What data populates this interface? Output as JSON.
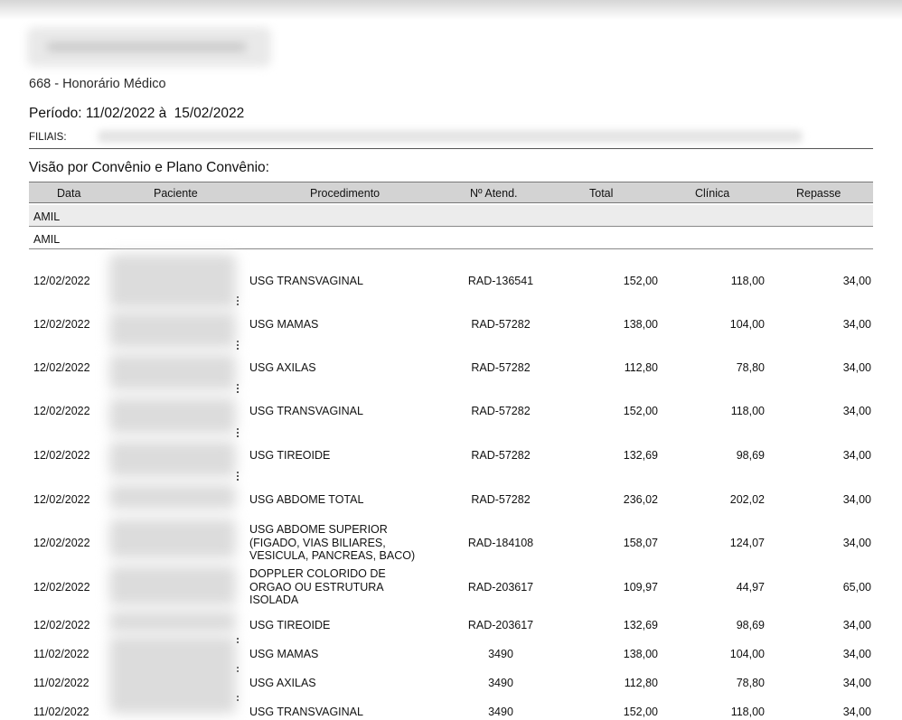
{
  "report": {
    "code_title": "668 - Honorário Médico",
    "period_label": "Período:",
    "period_start": "11/02/2022",
    "period_sep": "à",
    "period_end": "15/02/2022",
    "filiais_label": "FILIAIS:",
    "section_title": "Visão por Convênio e Plano Convênio:"
  },
  "table": {
    "headers": [
      "Data",
      "Paciente",
      "Procedimento",
      "Nº Atend.",
      "Total",
      "Clínica",
      "Repasse"
    ],
    "convenio": "AMIL",
    "plano": "AMIL",
    "rows": [
      {
        "date": "12/02/2022",
        "proc": [
          "USG TRANSVAGINAL"
        ],
        "atend": "RAD-136541",
        "total": "152,00",
        "clinica": "118,00",
        "repasse": "34,00"
      },
      {
        "date": "12/02/2022",
        "proc": [
          "USG MAMAS"
        ],
        "atend": "RAD-57282",
        "total": "138,00",
        "clinica": "104,00",
        "repasse": "34,00"
      },
      {
        "date": "12/02/2022",
        "proc": [
          "USG AXILAS"
        ],
        "atend": "RAD-57282",
        "total": "112,80",
        "clinica": "78,80",
        "repasse": "34,00"
      },
      {
        "date": "12/02/2022",
        "proc": [
          "USG TRANSVAGINAL"
        ],
        "atend": "RAD-57282",
        "total": "152,00",
        "clinica": "118,00",
        "repasse": "34,00"
      },
      {
        "date": "12/02/2022",
        "proc": [
          "USG TIREOIDE"
        ],
        "atend": "RAD-57282",
        "total": "132,69",
        "clinica": "98,69",
        "repasse": "34,00"
      },
      {
        "date": "12/02/2022",
        "proc": [
          "USG ABDOME TOTAL"
        ],
        "atend": "RAD-57282",
        "total": "236,02",
        "clinica": "202,02",
        "repasse": "34,00"
      },
      {
        "date": "12/02/2022",
        "proc": [
          "USG ABDOME SUPERIOR",
          "(FIGADO, VIAS BILIARES,",
          "VESICULA, PANCREAS, BACO)"
        ],
        "atend": "RAD-184108",
        "total": "158,07",
        "clinica": "124,07",
        "repasse": "34,00"
      },
      {
        "date": "12/02/2022",
        "proc": [
          "DOPPLER COLORIDO DE",
          "ORGAO OU ESTRUTURA",
          "ISOLADA"
        ],
        "atend": "RAD-203617",
        "total": "109,97",
        "clinica": "44,97",
        "repasse": "65,00"
      },
      {
        "date": "12/02/2022",
        "proc": [
          "USG TIREOIDE"
        ],
        "atend": "RAD-203617",
        "total": "132,69",
        "clinica": "98,69",
        "repasse": "34,00"
      },
      {
        "date": "11/02/2022",
        "proc": [
          "USG MAMAS"
        ],
        "atend": "3490",
        "total": "138,00",
        "clinica": "104,00",
        "repasse": "34,00"
      },
      {
        "date": "11/02/2022",
        "proc": [
          "USG AXILAS"
        ],
        "atend": "3490",
        "total": "112,80",
        "clinica": "78,80",
        "repasse": "34,00"
      },
      {
        "date": "11/02/2022",
        "proc": [
          "USG TRANSVAGINAL"
        ],
        "atend": "3490",
        "total": "152,00",
        "clinica": "118,00",
        "repasse": "34,00"
      }
    ]
  }
}
